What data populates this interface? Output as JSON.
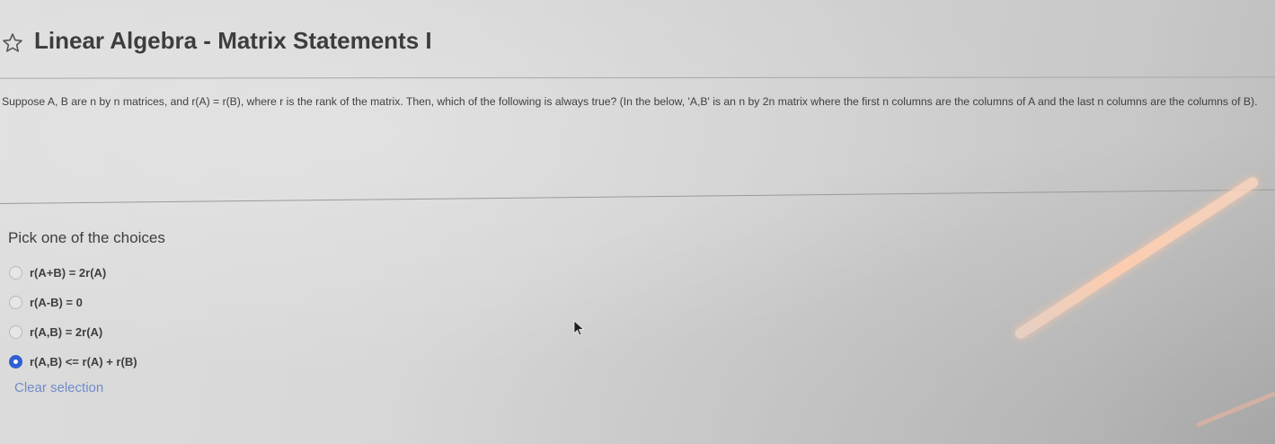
{
  "header": {
    "title": "Linear Algebra - Matrix Statements I"
  },
  "question": {
    "text": "Suppose A, B are n by n matrices, and r(A) = r(B), where r is the rank of the matrix. Then, which of the following is always true? (In the below, 'A,B' is an n by 2n matrix where the first n columns are the columns of A and the last n columns are the columns of B)."
  },
  "choices": {
    "heading": "Pick one of the choices",
    "options": [
      {
        "label": "r(A+B) = 2r(A)",
        "selected": false
      },
      {
        "label": "r(A-B) = 0",
        "selected": false
      },
      {
        "label": "r(A,B) = 2r(A)",
        "selected": false
      },
      {
        "label": "r(A,B) <= r(A) + r(B)",
        "selected": true
      }
    ],
    "clear_label": "Clear selection"
  },
  "icons": {
    "title_icon": "star-icon",
    "pointer": "mouse-cursor-icon"
  },
  "colors": {
    "accent": "#2f5fd0",
    "link": "#6f8cc9"
  }
}
